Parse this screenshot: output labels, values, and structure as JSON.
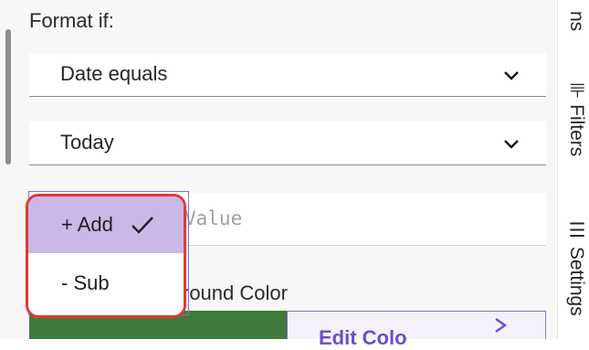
{
  "format": {
    "label": "Format if:"
  },
  "condition_select": {
    "value": "Date equals"
  },
  "date_select": {
    "value": "Today"
  },
  "value_input": {
    "placeholder": "Value"
  },
  "dropdown": {
    "items": [
      {
        "label": "+ Add",
        "selected": true
      },
      {
        "label": "- Sub",
        "selected": false
      }
    ]
  },
  "background": {
    "label": "round Color"
  },
  "edit_button": {
    "label": "Edit Colo"
  },
  "rail": {
    "items": [
      {
        "label": "ns"
      },
      {
        "label": "⊪ Filters"
      },
      {
        "label": "☰ Settings"
      }
    ]
  },
  "colors": {
    "menu_selected_bg": "#c9b8e8",
    "highlight_border": "#e03a2e",
    "accent_purple": "#8a6fd6",
    "green_swatch": "#3f7a3a"
  }
}
